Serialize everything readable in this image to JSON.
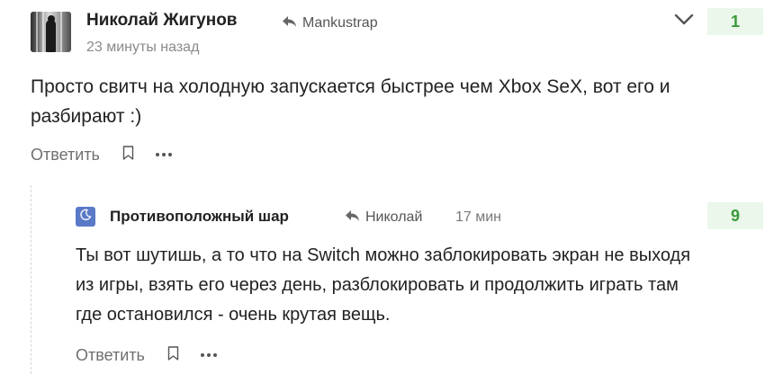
{
  "comments": [
    {
      "author": "Николай Жигунов",
      "reply_to": "Mankustrap",
      "time": "23 минуты назад",
      "rating": "1",
      "text": "Просто свитч на холодную запускается быстрее чем Xbox SeX, вот его и разбирают :)",
      "reply_label": "Ответить",
      "avatar_icon": "user-photo-icon"
    },
    {
      "author": "Противоположный шар",
      "reply_to": "Николай",
      "time": "17 мин",
      "rating": "9",
      "text": "Ты вот шутишь, а то что на Switch можно заблокировать экран не выходя из игры, взять его через день, разблокировать и продолжить играть там где остановился - очень крутая вещь.",
      "reply_label": "Ответить",
      "avatar_icon": "moon-icon"
    }
  ],
  "icons": {
    "reply_arrow": "reply-arrow-icon",
    "collapse": "chevron-down-icon",
    "bookmark": "bookmark-icon",
    "more": "more-dots-icon"
  },
  "colors": {
    "rating_bg": "#eaf7ea",
    "rating_text": "#3a9a3a",
    "avatar_2_bg": "#5a7ac8",
    "muted_text": "#8a8a8a"
  }
}
